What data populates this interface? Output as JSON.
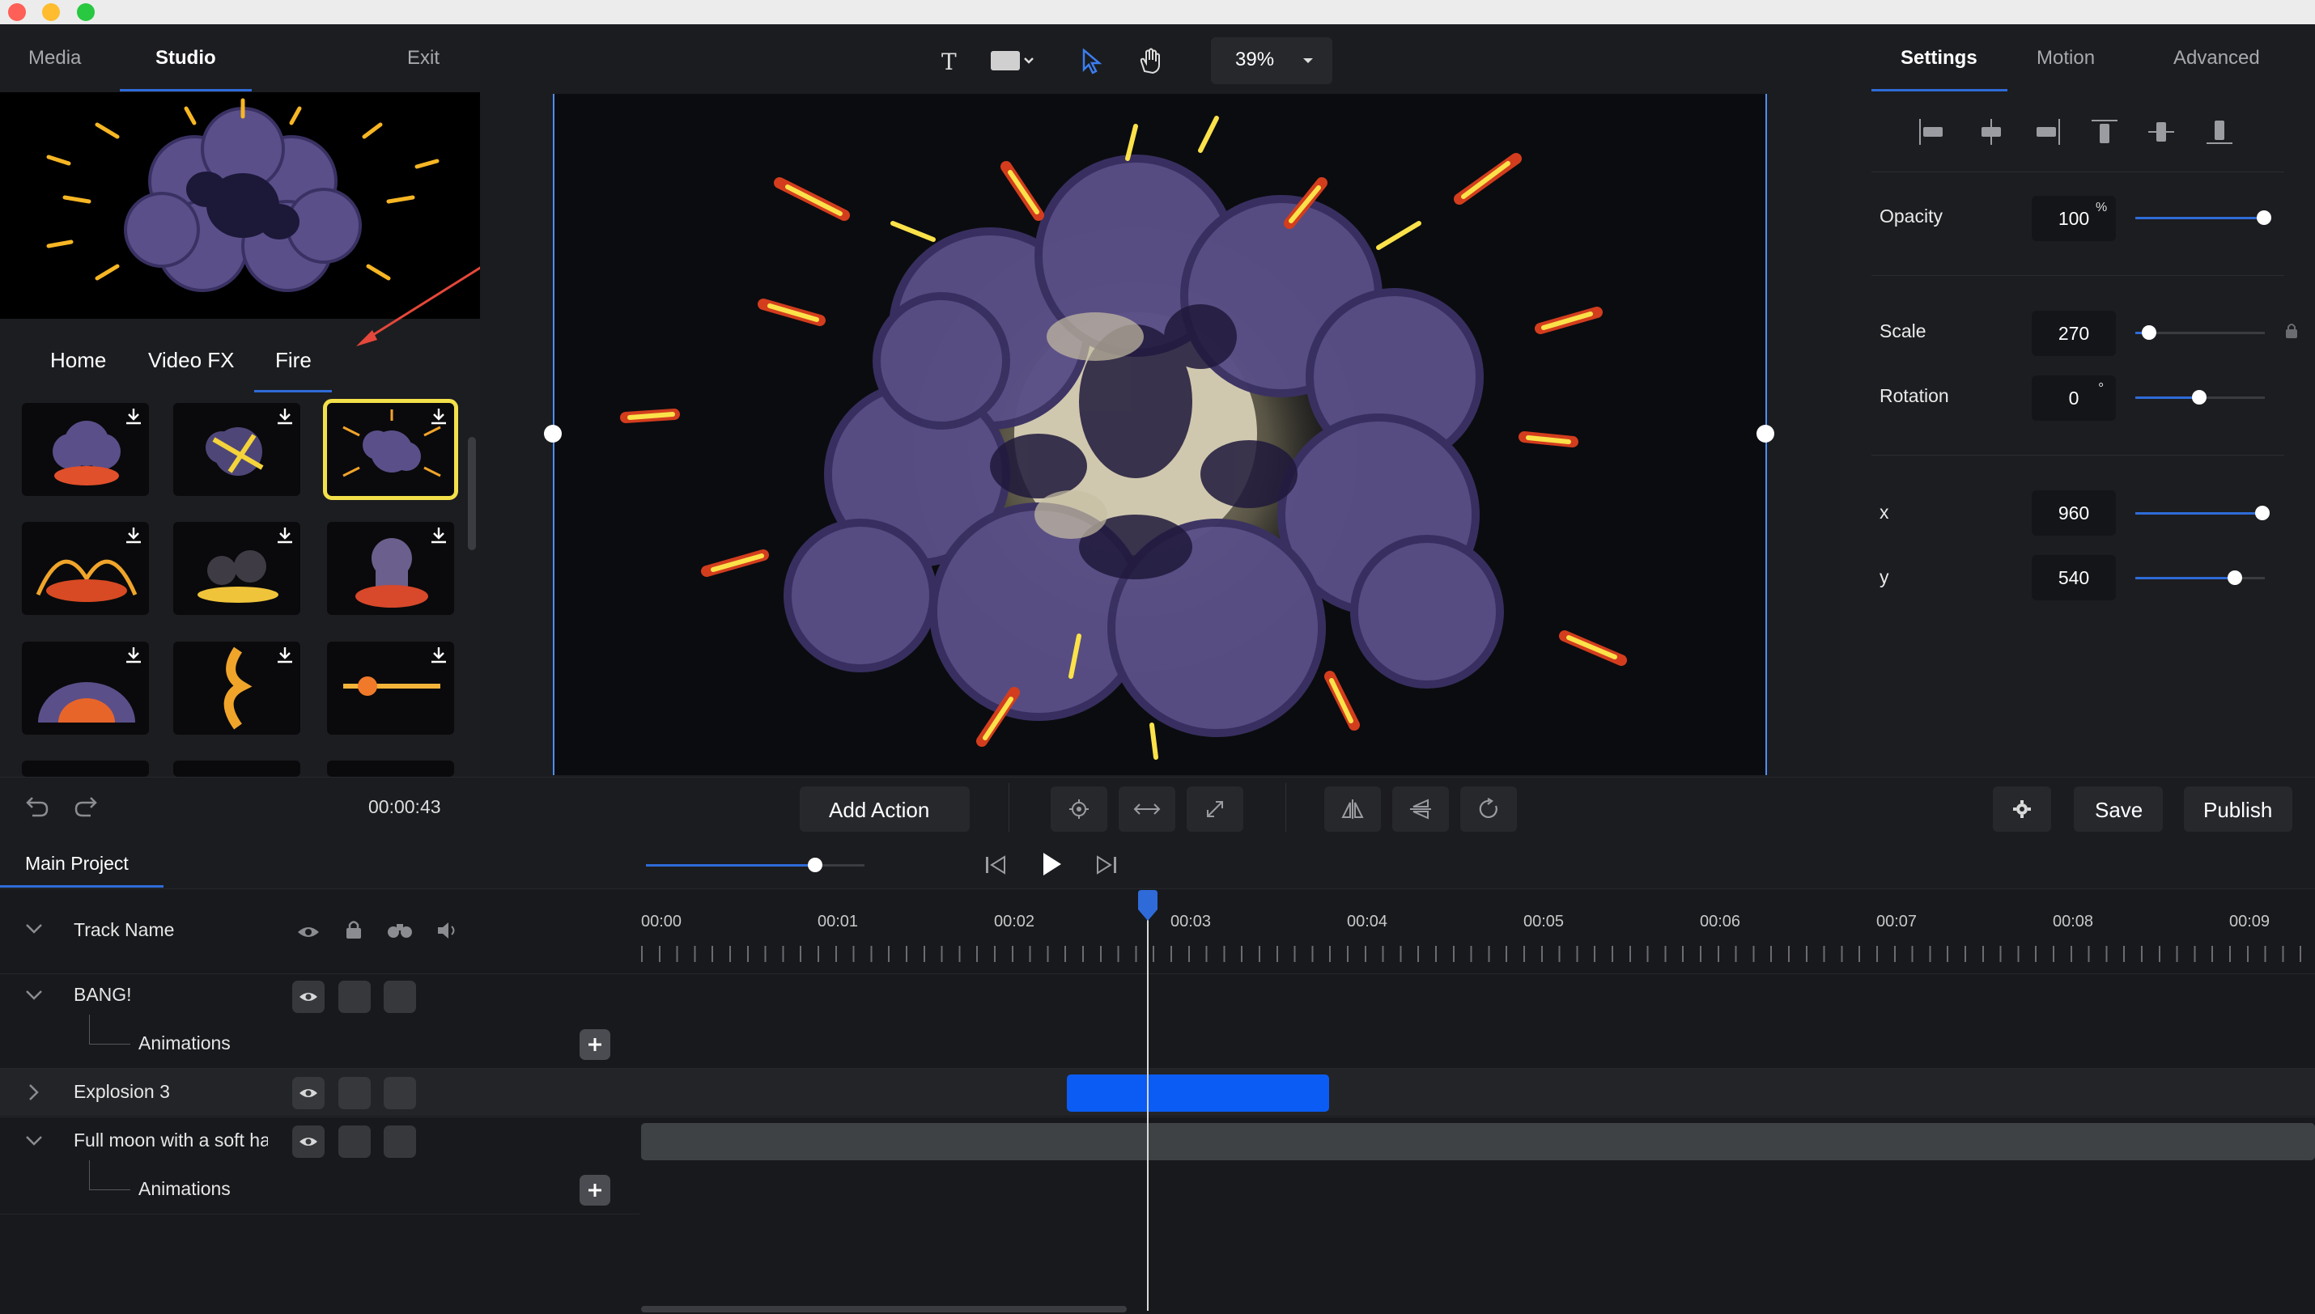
{
  "left_panel": {
    "tabs": [
      "Media",
      "Studio"
    ],
    "exit_label": "Exit",
    "category_tabs": [
      "Home",
      "Video FX",
      "Fire"
    ],
    "thumbnails": [
      {
        "name": "explosion-1",
        "download_icon": "download-icon"
      },
      {
        "name": "explosion-2",
        "download_icon": "download-icon"
      },
      {
        "name": "explosion-3",
        "download_icon": "download-icon",
        "selected": true
      },
      {
        "name": "fire-burst",
        "download_icon": "download-icon"
      },
      {
        "name": "fire-ground",
        "download_icon": "download-icon"
      },
      {
        "name": "fire-cloud",
        "download_icon": "download-icon"
      },
      {
        "name": "fire-dome",
        "download_icon": "download-icon"
      },
      {
        "name": "fire-column",
        "download_icon": "download-icon"
      },
      {
        "name": "fire-streak",
        "download_icon": "download-icon"
      }
    ]
  },
  "toolbar": {
    "zoom": "39%",
    "icons": [
      "text-tool-icon",
      "shape-tool-icon",
      "select-tool-icon",
      "hand-tool-icon"
    ]
  },
  "right_panel": {
    "tabs": [
      "Settings",
      "Motion",
      "Advanced"
    ],
    "opacity": {
      "label": "Opacity",
      "value": "100",
      "unit": "%",
      "level": 1.0
    },
    "scale": {
      "label": "Scale",
      "value": "270",
      "level": 0.05
    },
    "rotation": {
      "label": "Rotation",
      "value": "0",
      "unit": "°",
      "level": 0.5
    },
    "x": {
      "label": "x",
      "value": "960",
      "level": 1.0
    },
    "y": {
      "label": "y",
      "value": "540",
      "level": 0.78
    }
  },
  "action_bar": {
    "timecode": "00:00:43",
    "add_action": "Add Action",
    "save": "Save",
    "publish": "Publish"
  },
  "timeline": {
    "project_tab": "Main Project",
    "header_track_name": "Track Name",
    "ticks": [
      "00:00",
      "00:01",
      "00:02",
      "00:03",
      "00:04",
      "00:05",
      "00:06",
      "00:07",
      "00:08",
      "00:09"
    ],
    "tracks": [
      {
        "name": "BANG!",
        "sub": "Animations"
      },
      {
        "name": "Explosion 3"
      },
      {
        "name": "Full moon with a soft ha",
        "sub": "Animations"
      }
    ]
  },
  "colors": {
    "accent": "#2f6bd8",
    "clip_blue": "#0b5cf5",
    "selected_outline": "#f3e04a"
  }
}
